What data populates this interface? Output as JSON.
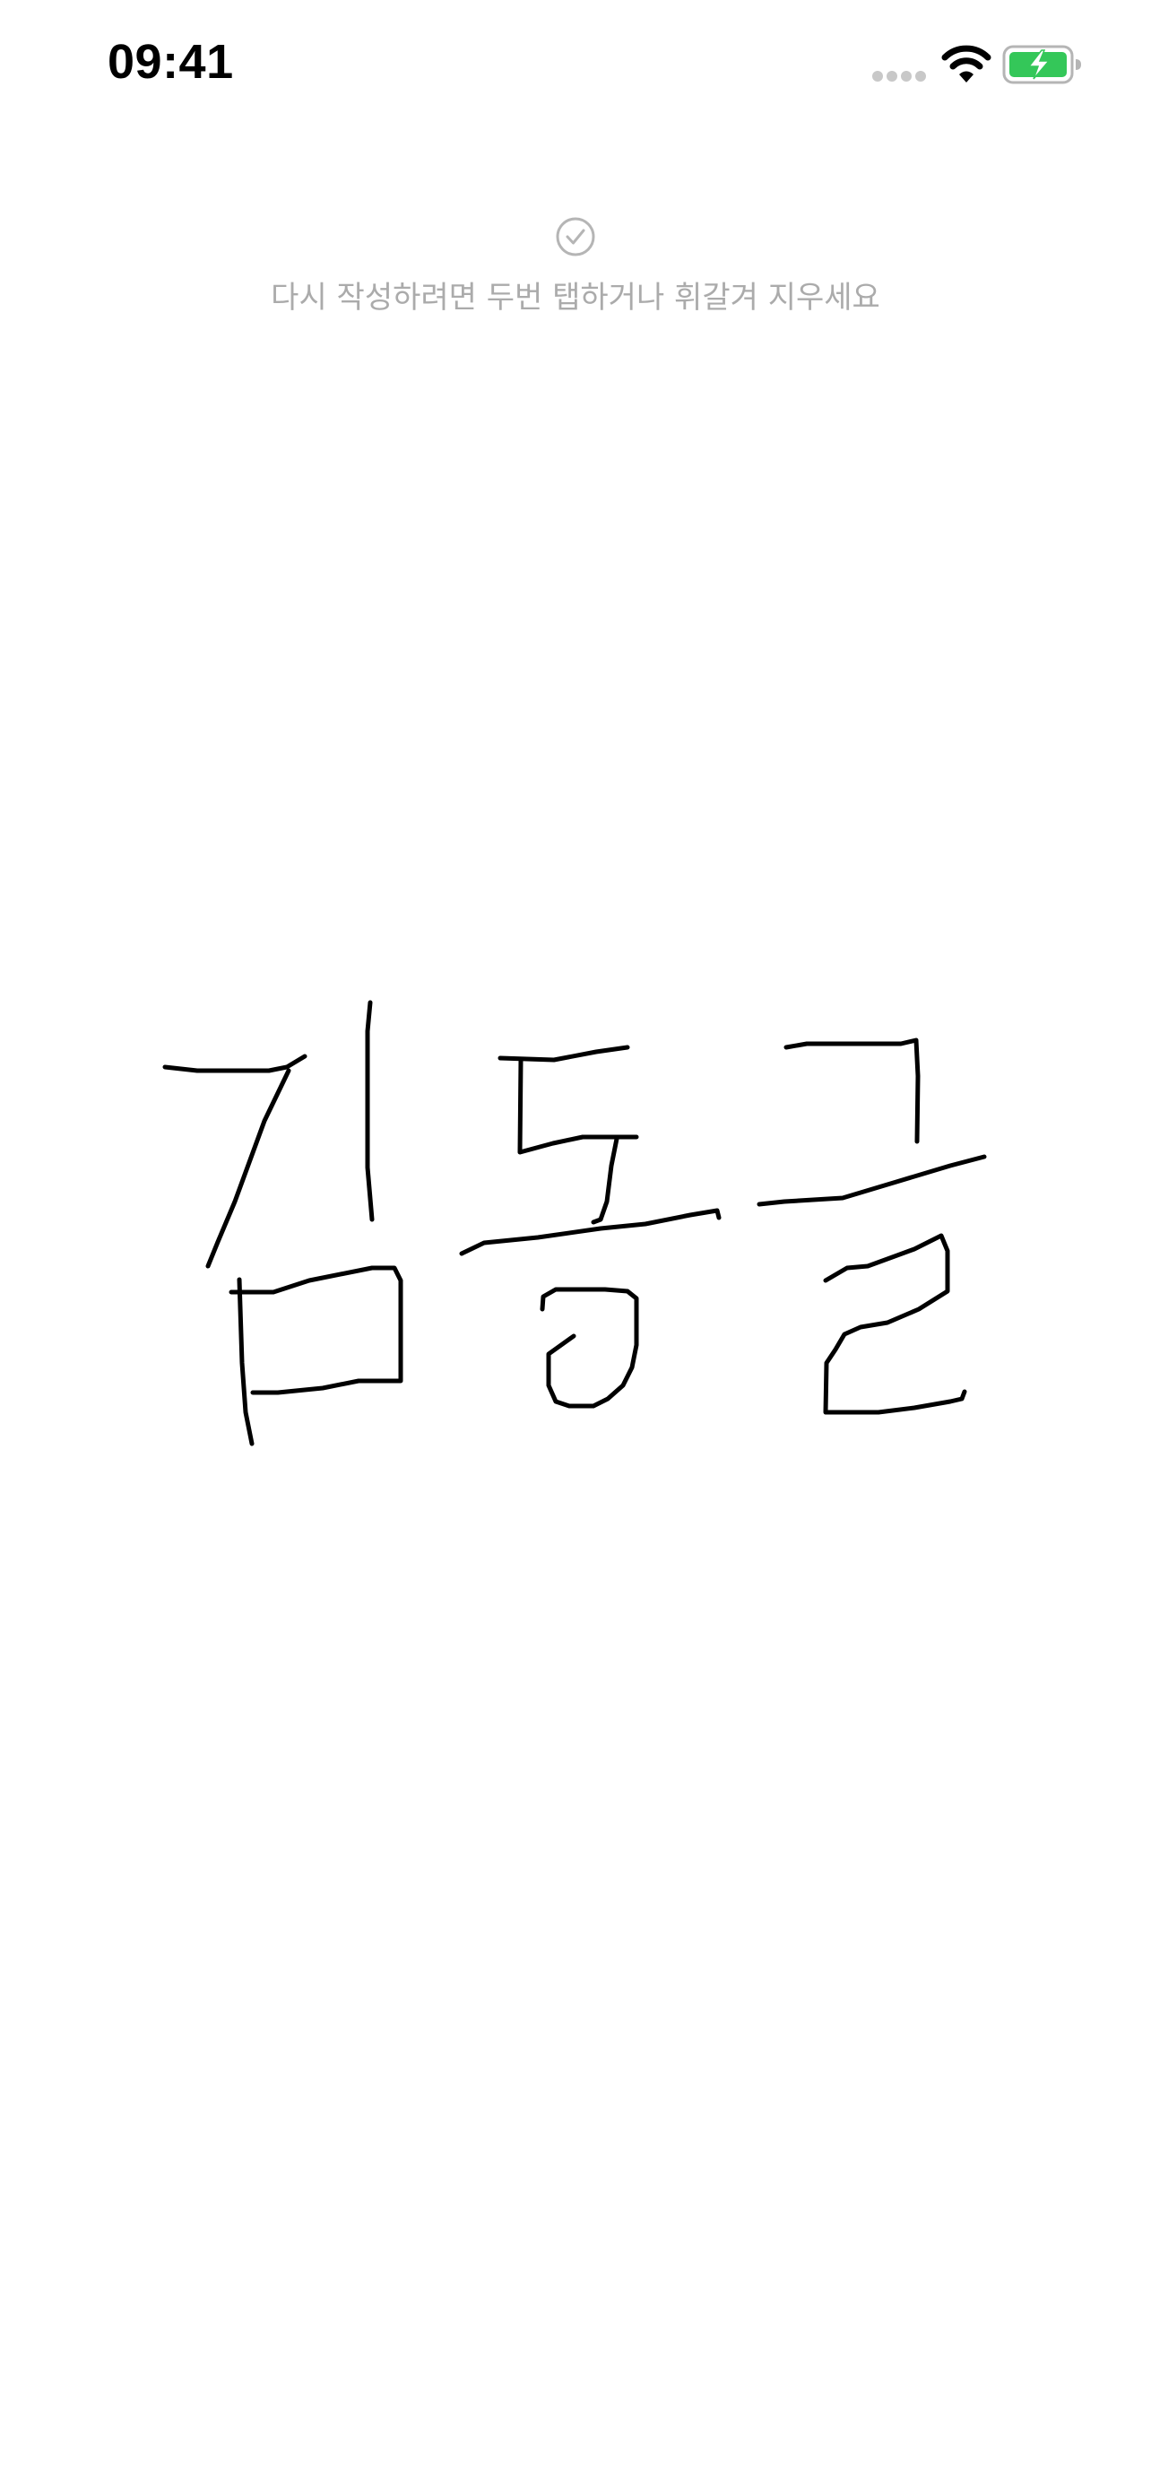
{
  "status_bar": {
    "time": "09:41",
    "battery": "charging"
  },
  "signature_pad": {
    "hint": "다시 작성하려면 두번 탭하거나 휘갈겨 지우세요",
    "check_icon": "checkmark-circle-icon",
    "signature": "김동글",
    "ink_color": "#000000"
  }
}
